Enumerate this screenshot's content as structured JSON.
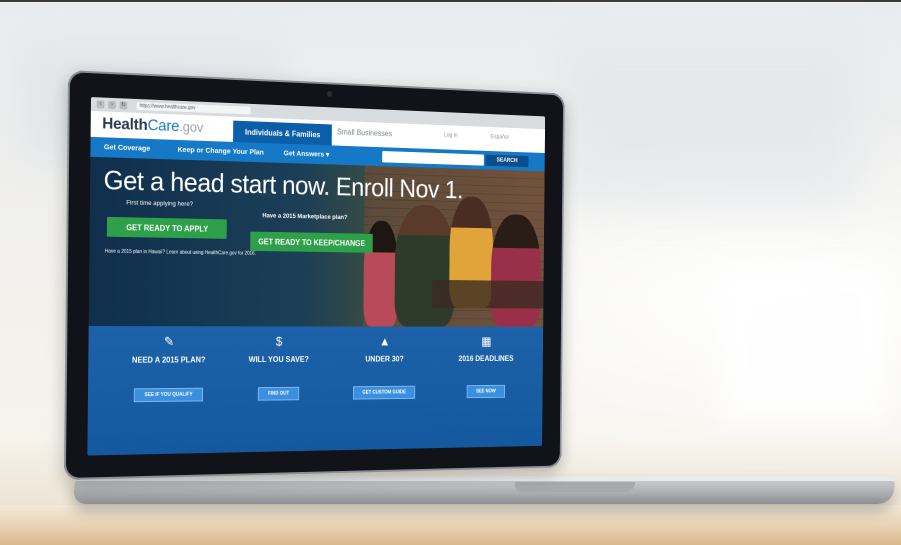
{
  "browser": {
    "url": "https://www.healthcare.gov"
  },
  "site": {
    "logo": {
      "part1": "Health",
      "part2": "Care",
      "part3": ".gov"
    },
    "tabs": {
      "individuals": "Individuals & Families",
      "small_business": "Small Businesses"
    },
    "top_links": {
      "login": "Log in",
      "espanol": "Español"
    },
    "nav": {
      "get_coverage": "Get Coverage",
      "keep_change": "Keep or Change Your Plan",
      "get_answers": "Get Answers ▾"
    },
    "search_button": "SEARCH"
  },
  "hero": {
    "headline": "Get a head start now. Enroll Nov 1.",
    "question_first": "First time applying here?",
    "question_returning": "Have a 2015 Marketplace plan?",
    "button_apply": "GET READY TO APPLY",
    "button_keep": "GET READY TO KEEP/CHANGE",
    "hawaii_note": "Have a 2015 plan in Hawaii? Learn about using HealthCare.gov for 2016."
  },
  "cards": [
    {
      "icon": "✎",
      "title": "NEED A 2015 PLAN?",
      "cta": "SEE IF YOU QUALIFY"
    },
    {
      "icon": "$",
      "title": "WILL YOU SAVE?",
      "cta": "FIND OUT"
    },
    {
      "icon": "▲",
      "title": "UNDER 30?",
      "cta": "GET CUSTOM GUIDE"
    },
    {
      "icon": "▦",
      "title": "2016 DEADLINES",
      "cta": "SEE NOW"
    }
  ]
}
